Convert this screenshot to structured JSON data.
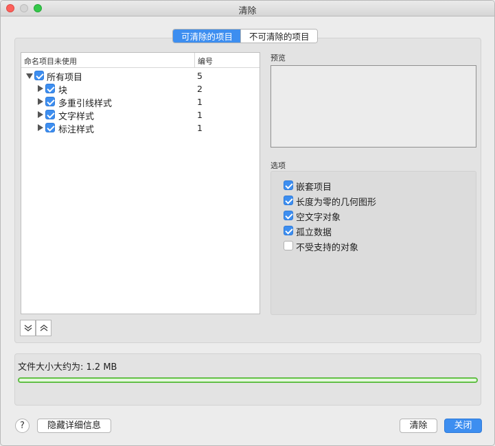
{
  "window": {
    "title": "清除"
  },
  "tabs": [
    {
      "label": "可清除的项目",
      "active": true
    },
    {
      "label": "不可清除的项目",
      "active": false
    }
  ],
  "tree": {
    "columns": {
      "name": "命名项目未使用",
      "number": "编号"
    },
    "rows": [
      {
        "label": "所有项目",
        "number": "5",
        "checked": true,
        "expanded": true
      },
      {
        "label": "块",
        "number": "2",
        "checked": true,
        "expanded": false
      },
      {
        "label": "多重引线样式",
        "number": "1",
        "checked": true,
        "expanded": false
      },
      {
        "label": "文字样式",
        "number": "1",
        "checked": true,
        "expanded": false
      },
      {
        "label": "标注样式",
        "number": "1",
        "checked": true,
        "expanded": false
      }
    ]
  },
  "preview": {
    "label": "预览"
  },
  "options": {
    "label": "选项",
    "items": [
      {
        "label": "嵌套项目",
        "checked": true
      },
      {
        "label": "长度为零的几何图形",
        "checked": true
      },
      {
        "label": "空文字对象",
        "checked": true
      },
      {
        "label": "孤立数据",
        "checked": true
      },
      {
        "label": "不受支持的对象",
        "checked": false
      }
    ]
  },
  "file_size": {
    "label": "文件大小大约为: 1.2 MB"
  },
  "buttons": {
    "help": "?",
    "hide_details": "隐藏详细信息",
    "purge": "清除",
    "close": "关闭"
  },
  "colors": {
    "accent": "#3d8ef0",
    "progress": "#6ccf4f"
  }
}
